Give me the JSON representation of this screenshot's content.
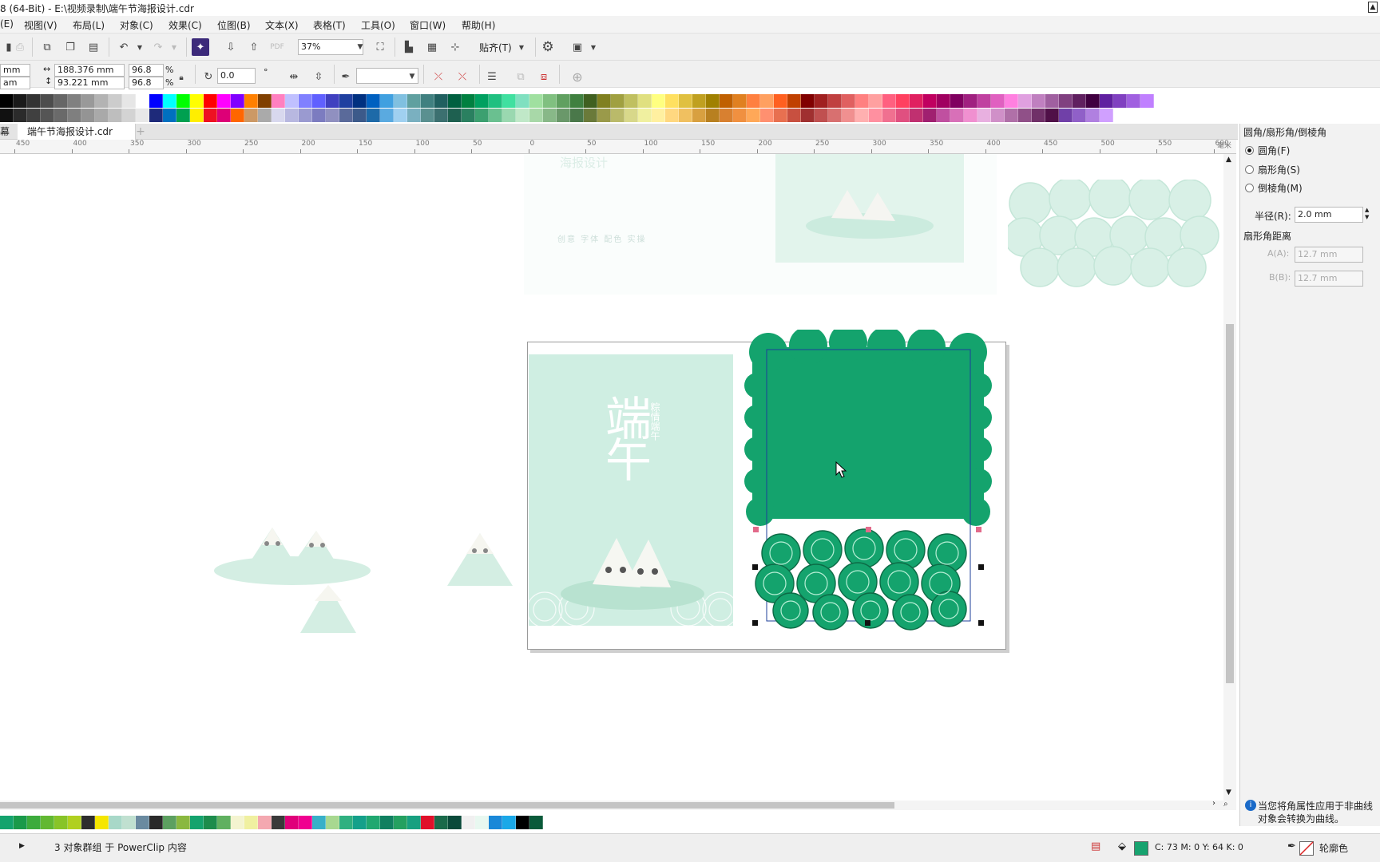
{
  "window": {
    "title": "8 (64-Bit) - E:\\视频录制\\端午节海报设计.cdr"
  },
  "menu": [
    "(E)",
    "视图(V)",
    "布局(L)",
    "对象(C)",
    "效果(C)",
    "位图(B)",
    "文本(X)",
    "表格(T)",
    "工具(O)",
    "窗口(W)",
    "帮助(H)"
  ],
  "toolbar": {
    "zoom": "37%",
    "snap_label": "贴齐(T)"
  },
  "property_bar": {
    "unit_x": "mm",
    "unit_y": "am",
    "width": "188.376 mm",
    "height": "93.221 mm",
    "scale_x": "96.8",
    "scale_y": "96.8",
    "percent": "%",
    "rotation": "0.0",
    "rotation_unit": "°"
  },
  "palette_colors_top": [
    "#000000",
    "#1a1a1a",
    "#333333",
    "#4d4d4d",
    "#666666",
    "#808080",
    "#999999",
    "#b3b3b3",
    "#cccccc",
    "#e6e6e6",
    "#ffffff",
    "#0000ff",
    "#00ffff",
    "#00ff00",
    "#ffff00",
    "#ff0000",
    "#ff00ff",
    "#8000ff",
    "#ff8000",
    "#804000",
    "#ff80c0",
    "#c0c0ff",
    "#8080ff",
    "#6060ff",
    "#4040c0",
    "#2040a0",
    "#003080",
    "#0060c0",
    "#40a0e0",
    "#80c0e0",
    "#60a0a0",
    "#408080",
    "#206060",
    "#006040",
    "#008040",
    "#00a060",
    "#20c080",
    "#40e0a0",
    "#80e0c0",
    "#a0e0a0",
    "#80c080",
    "#60a060",
    "#408040",
    "#406020",
    "#808020",
    "#a0a040",
    "#c0c060",
    "#e0e080",
    "#ffff80",
    "#ffe060",
    "#e0c040",
    "#c0a020",
    "#a08000",
    "#c06000",
    "#e08020",
    "#ff8040",
    "#ffa060",
    "#ff6020",
    "#c04000",
    "#800000",
    "#a02020",
    "#c04040",
    "#e06060",
    "#ff8080",
    "#ffa0a0",
    "#ff6080",
    "#ff4060",
    "#e02060",
    "#c00060",
    "#a00060",
    "#800060",
    "#a02080",
    "#c040a0",
    "#e060c0",
    "#ff80e0",
    "#e0a0e0",
    "#c080c0",
    "#a060a0",
    "#804080",
    "#602060",
    "#400040",
    "#6020a0",
    "#8040c0",
    "#a060e0",
    "#c080ff"
  ],
  "palette_colors_top2": [
    "#111111",
    "#2b2b2b",
    "#404040",
    "#555555",
    "#6a6a6a",
    "#7f7f7f",
    "#949494",
    "#a9a9a9",
    "#bebebe",
    "#d3d3d3",
    "#e8e8e8",
    "#1e2a7a",
    "#0070c0",
    "#00a050",
    "#ffee00",
    "#ee1122",
    "#dd0077",
    "#ff6600",
    "#cc9966",
    "#aaaaaa",
    "#d8d8ee",
    "#b8b8e0",
    "#9a9ad0",
    "#7c7cc0",
    "#9090c0",
    "#5a6a9a",
    "#3c5a8a",
    "#1e6aa8",
    "#5aaae0",
    "#a0d0f0",
    "#7ab0c0",
    "#5a9090",
    "#3c7070",
    "#1e6050",
    "#2a8060",
    "#3ca070",
    "#6ac090",
    "#9ad8b0",
    "#c0e8c8",
    "#a8d8a8",
    "#88b888",
    "#6a986a",
    "#4a784a",
    "#6a7a3a",
    "#9a9a4a",
    "#baba6a",
    "#d8d88a",
    "#f0f0a0",
    "#fff0a0",
    "#ffd880",
    "#f0c060",
    "#d8a040",
    "#b88020",
    "#d88030",
    "#f09040",
    "#ffa858",
    "#ff9070",
    "#e87050",
    "#c85040",
    "#a03030",
    "#c05050",
    "#d87070",
    "#f09090",
    "#ffb0b0",
    "#ff90a0",
    "#f07090",
    "#e05080",
    "#c03070",
    "#a02070",
    "#c050a0",
    "#d870b8",
    "#f090d0",
    "#e8b0e0",
    "#d090c8",
    "#b070a8",
    "#905088",
    "#703068",
    "#501048",
    "#7040a8",
    "#9060c8",
    "#b080e0",
    "#d0a0ff"
  ],
  "tabs": {
    "welcome": "幕",
    "document": "端午节海报设计.cdr",
    "add": "+"
  },
  "ruler_ticks": [
    "450",
    "400",
    "350",
    "300",
    "250",
    "200",
    "150",
    "100",
    "50",
    "0",
    "50",
    "100",
    "150",
    "200",
    "250",
    "300",
    "350",
    "400",
    "450",
    "500",
    "550",
    "600"
  ],
  "ruler_unit": "毫米",
  "canvas": {
    "ghost_title": "海报设计",
    "ghost_subtitle": "创意  字体  配色  实操",
    "poster_title_big": "端午",
    "poster_side_text": "粽情端午",
    "green_fill": "#14a36d",
    "mint": "#cfeee2"
  },
  "panel": {
    "title": "圆角/扇形角/倒棱角",
    "option_round": "圆角(F)",
    "option_scallop": "扇形角(S)",
    "option_chamfer": "倒棱角(M)",
    "radius_label": "半径(R):",
    "radius_value": "2.0 mm",
    "distance_label": "扇形角距离",
    "a_label": "A(A):",
    "a_value": "12.7 mm",
    "b_label": "B(B):",
    "b_value": "12.7 mm",
    "info_text_1": "当您将角属性应用于非曲线",
    "info_text_2": "对象会转换为曲线。"
  },
  "palette_bottom": [
    "#14a36d",
    "#1a9a4a",
    "#3cab3c",
    "#62b832",
    "#88c428",
    "#b0d020",
    "#2e2e2e",
    "#f5e600",
    "#a8d8c8",
    "#c0e0d0",
    "#6a8aa0",
    "#2a2a2a",
    "#5ca060",
    "#8ab840",
    "#14a36d",
    "#1c8c4c",
    "#60b060",
    "#f4f4d0",
    "#f0f0a0",
    "#f4a8b0",
    "#3a3a3a",
    "#e0007a",
    "#f00090",
    "#38b0c8",
    "#a8d890",
    "#30b080",
    "#14a08a",
    "#20a870",
    "#108060",
    "#24a060",
    "#18a080",
    "#e0102a",
    "#1a6a4a",
    "#0a4a3a",
    "#f0f0f0",
    "#e8f8f0",
    "#1a88d8",
    "#1aa8e8",
    "#000000",
    "#0a5a3a"
  ],
  "status": {
    "message": "3 对象群组 于 PowerClip 内容",
    "fill_info": "C: 73 M: 0 Y: 64 K: 0",
    "outline_label": "轮廓色",
    "fill_color": "#17a36f"
  }
}
